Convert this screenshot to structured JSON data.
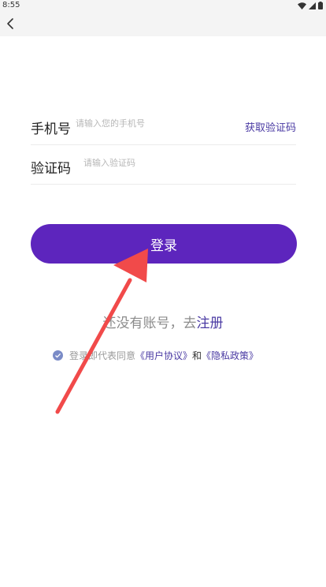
{
  "status_bar": {
    "time": "8:55"
  },
  "form": {
    "phone_label": "手机号",
    "phone_placeholder": "请输入您的手机号",
    "get_code_label": "获取验证码",
    "code_label": "验证码",
    "code_placeholder": "请输入验证码"
  },
  "login_button_label": "登录",
  "register": {
    "prompt": "还没有账号，去",
    "link": "注册"
  },
  "agreement": {
    "prefix": "登录即代表同意",
    "user_agreement": "《用户协议》",
    "and": "和",
    "privacy_policy": "《隐私政策》"
  },
  "colors": {
    "primary": "#5d25bd",
    "link": "#4a3aa3",
    "annotation_arrow": "#f14a4a"
  },
  "icons": {
    "back": "back-arrow-icon",
    "wifi": "wifi-icon",
    "signal": "signal-icon",
    "battery": "battery-icon",
    "check": "check-circle-icon"
  }
}
